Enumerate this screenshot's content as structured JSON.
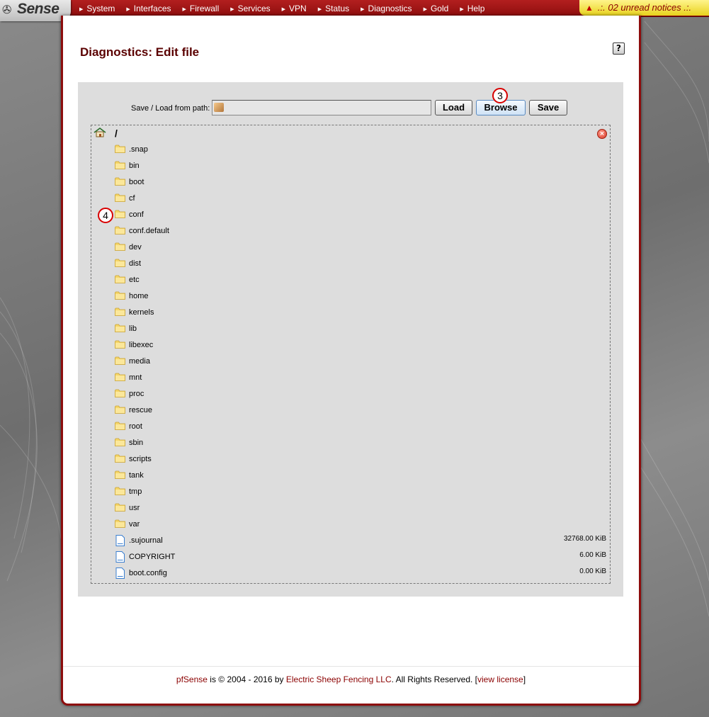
{
  "app": {
    "logo_text": "Sense",
    "notices": ".:. 02 unread notices .:."
  },
  "menu": [
    {
      "label": "System"
    },
    {
      "label": "Interfaces"
    },
    {
      "label": "Firewall"
    },
    {
      "label": "Services"
    },
    {
      "label": "VPN"
    },
    {
      "label": "Status"
    },
    {
      "label": "Diagnostics"
    },
    {
      "label": "Gold"
    },
    {
      "label": "Help"
    }
  ],
  "page": {
    "title": "Diagnostics: Edit file",
    "help_label": "?"
  },
  "editor": {
    "path_label": "Save / Load from path:",
    "path_value": "",
    "load_label": "Load",
    "browse_label": "Browse",
    "save_label": "Save",
    "marker_browse": "3",
    "marker_conf": "4"
  },
  "browser": {
    "current_path": "/",
    "items": [
      {
        "type": "folder",
        "name": ".snap",
        "size": ""
      },
      {
        "type": "folder",
        "name": "bin",
        "size": ""
      },
      {
        "type": "folder",
        "name": "boot",
        "size": ""
      },
      {
        "type": "folder",
        "name": "cf",
        "size": ""
      },
      {
        "type": "folder",
        "name": "conf",
        "size": ""
      },
      {
        "type": "folder",
        "name": "conf.default",
        "size": ""
      },
      {
        "type": "folder",
        "name": "dev",
        "size": ""
      },
      {
        "type": "folder",
        "name": "dist",
        "size": ""
      },
      {
        "type": "folder",
        "name": "etc",
        "size": ""
      },
      {
        "type": "folder",
        "name": "home",
        "size": ""
      },
      {
        "type": "folder",
        "name": "kernels",
        "size": ""
      },
      {
        "type": "folder",
        "name": "lib",
        "size": ""
      },
      {
        "type": "folder",
        "name": "libexec",
        "size": ""
      },
      {
        "type": "folder",
        "name": "media",
        "size": ""
      },
      {
        "type": "folder",
        "name": "mnt",
        "size": ""
      },
      {
        "type": "folder",
        "name": "proc",
        "size": ""
      },
      {
        "type": "folder",
        "name": "rescue",
        "size": ""
      },
      {
        "type": "folder",
        "name": "root",
        "size": ""
      },
      {
        "type": "folder",
        "name": "sbin",
        "size": ""
      },
      {
        "type": "folder",
        "name": "scripts",
        "size": ""
      },
      {
        "type": "folder",
        "name": "tank",
        "size": ""
      },
      {
        "type": "folder",
        "name": "tmp",
        "size": ""
      },
      {
        "type": "folder",
        "name": "usr",
        "size": ""
      },
      {
        "type": "folder",
        "name": "var",
        "size": ""
      },
      {
        "type": "file",
        "name": ".sujournal",
        "size": "32768.00 KiB"
      },
      {
        "type": "file",
        "name": "COPYRIGHT",
        "size": "6.00 KiB"
      },
      {
        "type": "file",
        "name": "boot.config",
        "size": "0.00 KiB"
      }
    ]
  },
  "footer": {
    "brand": "pfSense",
    "text_mid": " is © 2004 - 2016 by ",
    "company": "Electric Sheep Fencing LLC",
    "text_end": ". All Rights Reserved. [",
    "license": "view license",
    "bracket_close": "]"
  },
  "colors": {
    "brand_red": "#8d0d0d",
    "title_red": "#5a0000",
    "notice_yellow": "#f2e24a",
    "folder_yellow": "#f5d66a",
    "file_blue": "#3a7fd0"
  }
}
